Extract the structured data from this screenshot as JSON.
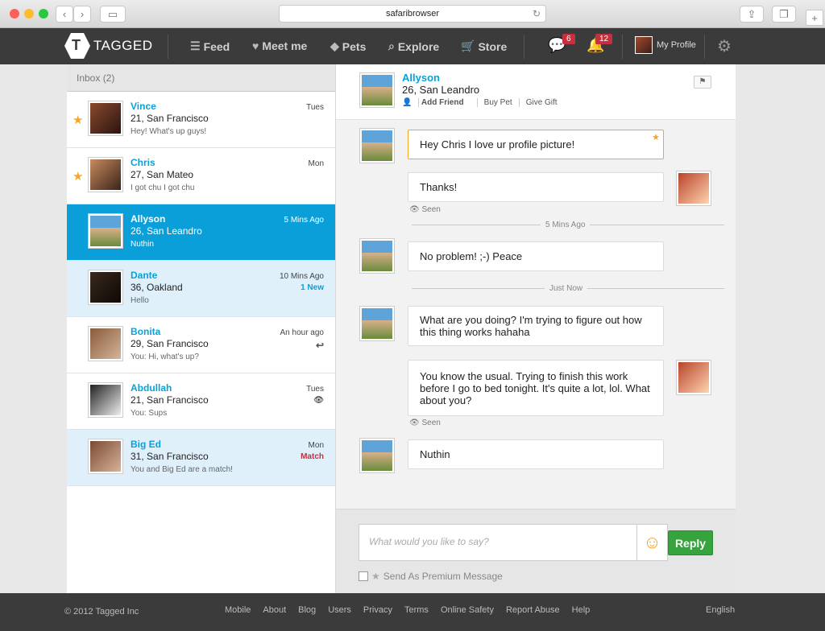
{
  "browser": {
    "url": "safaribrowser"
  },
  "nav": {
    "brand": "TAGGED",
    "feed": "Feed",
    "meetme": "Meet me",
    "pets": "Pets",
    "explore": "Explore",
    "store": "Store",
    "msg_count": "6",
    "notif_count": "12",
    "profile": "My Profile"
  },
  "inbox": {
    "title": "Inbox (2)",
    "items": [
      {
        "name": "Vince",
        "info": "21, San Francisco",
        "msg": "Hey! What's up guys!",
        "time": "Tues",
        "tag": ""
      },
      {
        "name": "Chris",
        "info": "27, San Mateo",
        "msg": "I got chu I got chu",
        "time": "Mon",
        "tag": ""
      },
      {
        "name": "Allyson",
        "info": "26, San Leandro",
        "msg": "Nuthin",
        "time": "5 Mins Ago",
        "tag": ""
      },
      {
        "name": "Dante",
        "info": "36, Oakland",
        "msg": "Hello",
        "time": "10 Mins Ago",
        "tag": "1 New"
      },
      {
        "name": "Bonita",
        "info": "29, San Francisco",
        "msg": "You: Hi, what's up?",
        "time": "An hour ago",
        "tag": "↩"
      },
      {
        "name": "Abdullah",
        "info": "21, San Francisco",
        "msg": "You: Sups",
        "time": "Tues",
        "tag": "👁"
      },
      {
        "name": "Big Ed",
        "info": "31, San Francisco",
        "msg": "You and Big Ed are a match!",
        "time": "Mon",
        "tag": "Match"
      }
    ]
  },
  "chat": {
    "name": "Allyson",
    "info": "26, San Leandro",
    "add_friend": "Add Friend",
    "buy_pet": "Buy Pet",
    "give_gift": "Give Gift",
    "messages": [
      "Hey Chris I love ur profile picture!",
      "Thanks!",
      "No problem! ;-) Peace",
      "What are you doing? I'm trying to figure out how this thing works hahaha",
      "You know the usual. Trying to finish this work before I go to bed tonight. It's quite a lot, lol. What about you?",
      "Nuthin"
    ],
    "seen": "Seen",
    "divider1": "5 Mins Ago",
    "divider2": "Just Now",
    "placeholder": "What  would you like to say?",
    "reply": "Reply",
    "premium": "Send As Premium Message"
  },
  "footer": {
    "copyright": "© 2012 Tagged Inc",
    "links": [
      "Mobile",
      "About",
      "Blog",
      "Users",
      "Privacy",
      "Terms",
      "Online Safety",
      "Report Abuse",
      "Help"
    ],
    "language": "English"
  }
}
